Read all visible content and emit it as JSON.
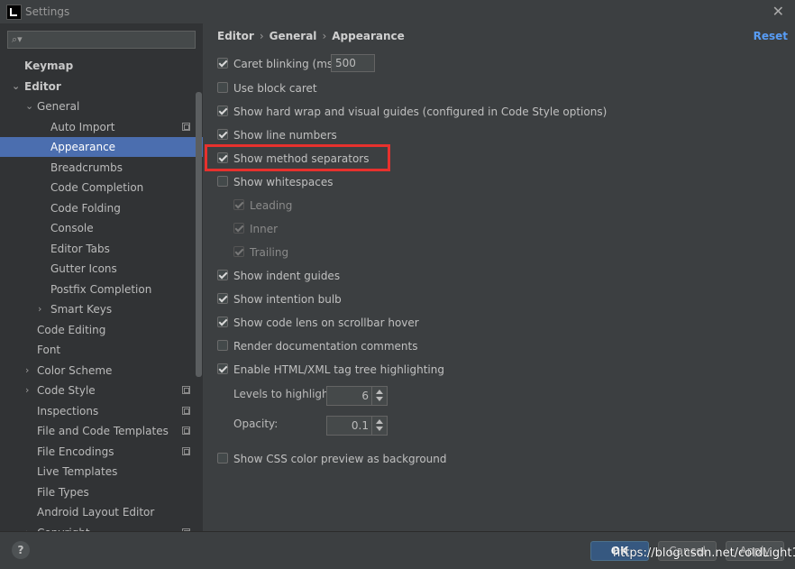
{
  "window": {
    "title": "Settings"
  },
  "sidebar": {
    "search_placeholder": "",
    "items": [
      {
        "label": "Keymap"
      },
      {
        "label": "Editor"
      },
      {
        "label": "General"
      },
      {
        "label": "Auto Import"
      },
      {
        "label": "Appearance"
      },
      {
        "label": "Breadcrumbs"
      },
      {
        "label": "Code Completion"
      },
      {
        "label": "Code Folding"
      },
      {
        "label": "Console"
      },
      {
        "label": "Editor Tabs"
      },
      {
        "label": "Gutter Icons"
      },
      {
        "label": "Postfix Completion"
      },
      {
        "label": "Smart Keys"
      },
      {
        "label": "Code Editing"
      },
      {
        "label": "Font"
      },
      {
        "label": "Color Scheme"
      },
      {
        "label": "Code Style"
      },
      {
        "label": "Inspections"
      },
      {
        "label": "File and Code Templates"
      },
      {
        "label": "File Encodings"
      },
      {
        "label": "Live Templates"
      },
      {
        "label": "File Types"
      },
      {
        "label": "Android Layout Editor"
      },
      {
        "label": "Copyright"
      }
    ]
  },
  "breadcrumb": {
    "part1": "Editor",
    "part2": "General",
    "part3": "Appearance",
    "separator": "›"
  },
  "reset_label": "Reset",
  "options": {
    "caret_blinking": {
      "label": "Caret blinking (ms):",
      "checked": true,
      "value": "500"
    },
    "block_caret": {
      "label": "Use block caret",
      "checked": false
    },
    "hard_wrap": {
      "label": "Show hard wrap and visual guides (configured in Code Style options)",
      "checked": true
    },
    "line_numbers": {
      "label": "Show line numbers",
      "checked": true
    },
    "method_separators": {
      "label": "Show method separators",
      "checked": true
    },
    "whitespaces": {
      "label": "Show whitespaces",
      "checked": false
    },
    "leading": {
      "label": "Leading",
      "checked": true
    },
    "inner": {
      "label": "Inner",
      "checked": true
    },
    "trailing": {
      "label": "Trailing",
      "checked": true
    },
    "indent_guides": {
      "label": "Show indent guides",
      "checked": true
    },
    "intention_bulb": {
      "label": "Show intention bulb",
      "checked": true
    },
    "code_lens": {
      "label": "Show code lens on scrollbar hover",
      "checked": true
    },
    "render_docs": {
      "label": "Render documentation comments",
      "checked": false
    },
    "tag_tree": {
      "label": "Enable HTML/XML tag tree highlighting",
      "checked": true
    },
    "levels": {
      "label": "Levels to highlight:",
      "value": "6"
    },
    "opacity": {
      "label": "Opacity:",
      "value": "0.1"
    },
    "css_preview": {
      "label": "Show CSS color preview as background",
      "checked": false
    }
  },
  "footer": {
    "help": "?",
    "ok": "OK",
    "cancel": "Cancel",
    "apply": "Apply",
    "watermark": "https://blog.csdn.net/coldLight1"
  },
  "colors": {
    "accent": "#4b6eaf",
    "highlight_box": "#e7312d",
    "link": "#589df6"
  }
}
